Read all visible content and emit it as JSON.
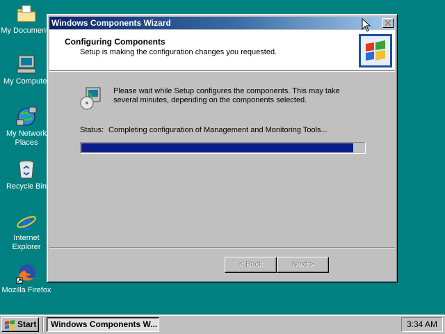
{
  "desktop": {
    "icons": [
      {
        "label": "My Documents",
        "icon": "folder-icon"
      },
      {
        "label": "My Computer",
        "icon": "computer-icon"
      },
      {
        "label": "My Network Places",
        "icon": "network-icon"
      },
      {
        "label": "Recycle Bin",
        "icon": "recycle-bin-icon"
      },
      {
        "label": "Internet Explorer",
        "icon": "ie-icon"
      },
      {
        "label": "Mozilla Firefox",
        "icon": "firefox-icon"
      }
    ]
  },
  "wizard": {
    "title": "Windows Components Wizard",
    "header_title": "Configuring Components",
    "header_subtitle": "Setup is making the configuration changes you requested.",
    "message": "Please wait while Setup configures the components. This may take several minutes, depending on the components selected.",
    "status_label": "Status:",
    "status_text": "Completing configuration of Management and Monitoring Tools...",
    "progress": 0.96,
    "back_label": "< Back",
    "next_label": "Next >"
  },
  "taskbar": {
    "start_label": "Start",
    "task_label": "Windows Components W...",
    "clock": "3:34 AM"
  },
  "colors": {
    "desktop": "#008080",
    "title_start": "#0a246a",
    "progress_fill": "#0a1e8c"
  }
}
